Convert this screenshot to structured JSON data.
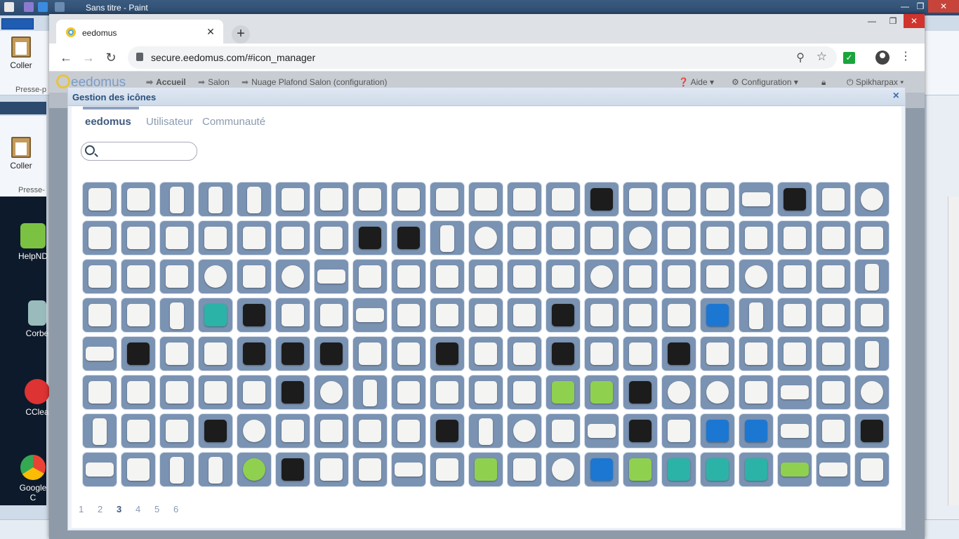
{
  "paint": {
    "title": "Sans titre - Paint",
    "ribbon": {
      "paste_label": "Coller",
      "group_label": "Presse-p",
      "group_label_2": "Presse-"
    },
    "desktop": [
      {
        "label": "HelpND",
        "icon": "help-icon"
      },
      {
        "label": "Corbe",
        "icon": "recycle-bin-icon"
      },
      {
        "label": "CClea",
        "icon": "ccleaner-icon"
      },
      {
        "label": "Google C",
        "icon": "google-chrome-icon"
      }
    ]
  },
  "browser": {
    "tab_title": "eedomus",
    "url": "secure.eedomus.com/#icon_manager",
    "new_tab": "+",
    "close_tab": "✕"
  },
  "page": {
    "logo_text": "eedomus",
    "breadcrumbs": [
      "Accueil",
      "Salon",
      "Nuage Plafond Salon (configuration)"
    ],
    "help": "Aide",
    "configuration": "Configuration",
    "user": "Spikharpax"
  },
  "modal": {
    "title": "Gestion des icônes",
    "close": "×",
    "tabs": [
      "eedomus",
      "Utilisateur",
      "Communauté"
    ],
    "search": {
      "value": "",
      "placeholder": ""
    },
    "pages": [
      "1",
      "2",
      "3",
      "4",
      "5",
      "6"
    ],
    "current_page": "3"
  },
  "colors": {
    "tile_bg": "#7b93b3",
    "accent": "#3e5a80",
    "modal_title": "#2b4f7a"
  },
  "icons": [
    [
      "zibase-box-icon",
      "smart-plug-icon",
      "door-sensor-icon",
      "shutter-switch-icon",
      "shutter-switch-icon-2",
      "radiator-valve-icon",
      "doorbell-button-icon",
      "power-clamp-icon",
      "weather-station-icon",
      "wind-sensor-icon",
      "anemometer-icon",
      "weather-mast-icon",
      "wall-module-icon",
      "black-thermostat-icon",
      "rain-gauge-icon",
      "motion-sensor-icon",
      "relay-board-icon",
      "wire-sensor-icon",
      "remote-sensor-icon",
      "wall-plug-icon",
      "eedomus-ring-icon"
    ],
    [
      "ceiling-sensor-icon",
      "camera-adapter-icon",
      "window-sensor-icon",
      "micro-module-icon",
      "relay-module-icon",
      "relay-module-icon-2",
      "dimmer-module-icon",
      "key-fob-icon",
      "remote-control-icon",
      "door-contact-icon",
      "round-sensor-icon",
      "dimmer-icon",
      "power-adapter-icon",
      "cable-set-icon",
      "wiring-kit-icon",
      "plug-adapter-icon",
      "switch-module-icon",
      "white-square-icon",
      "pipe-sensor-icon",
      "wall-switch-icon",
      "flat-panel-icon"
    ],
    [
      "white-box-icon",
      "white-hub-icon",
      "glass-panel-icon",
      "smoke-detector-icon",
      "door-lock-icon",
      "light-bulb-icon",
      "fibaro-module-icon",
      "siren-icon",
      "smart-plug-icon-2",
      "wall-socket-icon",
      "socket-led-icon",
      "white-cube-icon",
      "flat-sensor-icon",
      "round-module-icon",
      "button-panel-icon",
      "cylinder-speaker-icon",
      "echo-dot-icon",
      "bulb-socket-icon",
      "energy-plug-icon",
      "energy-plug-icon-2",
      "slim-plug-icon"
    ],
    [
      "pir-sensor-icon",
      "corner-sensor-icon",
      "door-sensor-icon-2",
      "music-icon",
      "camera-icon",
      "lcd-thermometer-icon",
      "square-module-icon",
      "usb-dongle-icon",
      "wall-panel-icon",
      "corner-motion-icon",
      "emergency-button-icon",
      "ruler-sensor-icon",
      "remote-stick-icon",
      "red-sensor-icon",
      "small-sensor-icon",
      "switch-board-icon",
      "bluetooth-icon",
      "tall-sensor-icon",
      "flood-sensor-icon",
      "green-box-icon",
      "white-panel-icon"
    ],
    [
      "antenna-icon",
      "black-hub-icon",
      "camera-box-icon",
      "camera-box-icon-2",
      "security-camera-icon",
      "ip-camera-icon",
      "cube-camera-icon",
      "glass-switch-icon",
      "webcam-icon",
      "baby-camera-icon",
      "router-icon",
      "smart-socket-icon",
      "remote-holder-icon",
      "double-switch-icon",
      "cable-loop-icon",
      "slim-remote-icon",
      "wall-socket-icon-2",
      "video-doorbell-icon",
      "glass-switch-icon-2",
      "double-switch-icon-2",
      "slim-switch-icon"
    ],
    [
      "din-module-icon",
      "light-panel-icon",
      "desk-lamp-icon",
      "relay-switch-icon",
      "relay-switch-icon-2",
      "keypad-remote-icon",
      "bulb-holder-icon",
      "door-contact-icon-2",
      "wall-outlet-icon",
      "cast-icon",
      "din-rail-icon",
      "hand-sensor-icon",
      "green-hub-icon",
      "green-hub-icon-2",
      "black-knob-icon",
      "grey-knob-icon",
      "thermostat-dial-icon",
      "radiator-head-icon",
      "power-strip-icon",
      "meter-icon",
      "wifi-icon"
    ],
    [
      "door-handle-icon",
      "grey-sensor-icon",
      "wall-lamp-icon",
      "old-tv-icon",
      "smoke-alarm-icon",
      "plug-outlet-icon",
      "siren-speaker-icon",
      "key-box-icon",
      "window-contact-icon",
      "door-camera-icon",
      "column-sensor-icon",
      "round-meter-icon",
      "double-plug-icon",
      "power-bar-icon",
      "nest-thermostat-icon",
      "din-meter-icon",
      "edisio-icon",
      "edisio-icon-2",
      "usb-stick-icon",
      "button-plate-icon",
      "black-box-icon"
    ],
    [
      "relay-card-icon",
      "micro-relay-icon",
      "door-sensor-icon-3",
      "tube-sensor-icon",
      "smiley-icon",
      "car-key-icon",
      "shutter-icon",
      "white-router-icon",
      "white-card-icon",
      "speech-bubble-icon",
      "green-board-icon",
      "white-frame-icon",
      "dial-thermostat-icon",
      "blue-module-icon",
      "green-logo-icon",
      "dolphin-icon",
      "dolphin-icon-2",
      "dolphin-icon-3",
      "green-stick-icon",
      "wood-board-icon",
      "wall-thermostat-icon"
    ]
  ]
}
